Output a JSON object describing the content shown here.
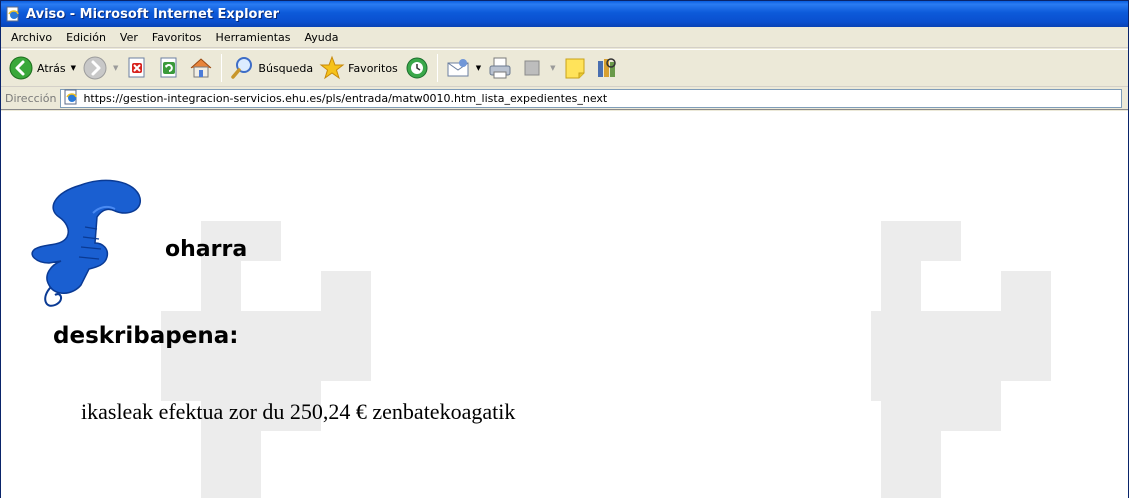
{
  "window": {
    "title": "Aviso - Microsoft Internet Explorer"
  },
  "menu": {
    "items": [
      "Archivo",
      "Edición",
      "Ver",
      "Favoritos",
      "Herramientas",
      "Ayuda"
    ]
  },
  "toolbar": {
    "back_label": "Atrás",
    "search_label": "Búsqueda",
    "favorites_label": "Favoritos"
  },
  "address": {
    "label": "Dirección",
    "url": "https://gestion-integracion-servicios.ehu.es/pls/entrada/matw0010.htm_lista_expedientes_next"
  },
  "page": {
    "heading": "oharra",
    "description_label": "deskribapena:",
    "message": "ikasleak efektua zor du 250,24 € zenbatekoagatik"
  },
  "colors": {
    "title_bar": "#0a5ee0",
    "window_frame": "#ece9d8",
    "phone_blue": "#1a5fd1",
    "watermark": "#ebebeb"
  },
  "icons": [
    "ie-page-icon",
    "back-arrow-icon",
    "forward-arrow-icon",
    "stop-icon",
    "refresh-icon",
    "home-icon",
    "search-magnifier-icon",
    "favorites-star-icon",
    "history-icon",
    "mail-icon",
    "print-icon",
    "edit-icon",
    "notes-icon",
    "research-icon",
    "telephone-logo-icon"
  ]
}
